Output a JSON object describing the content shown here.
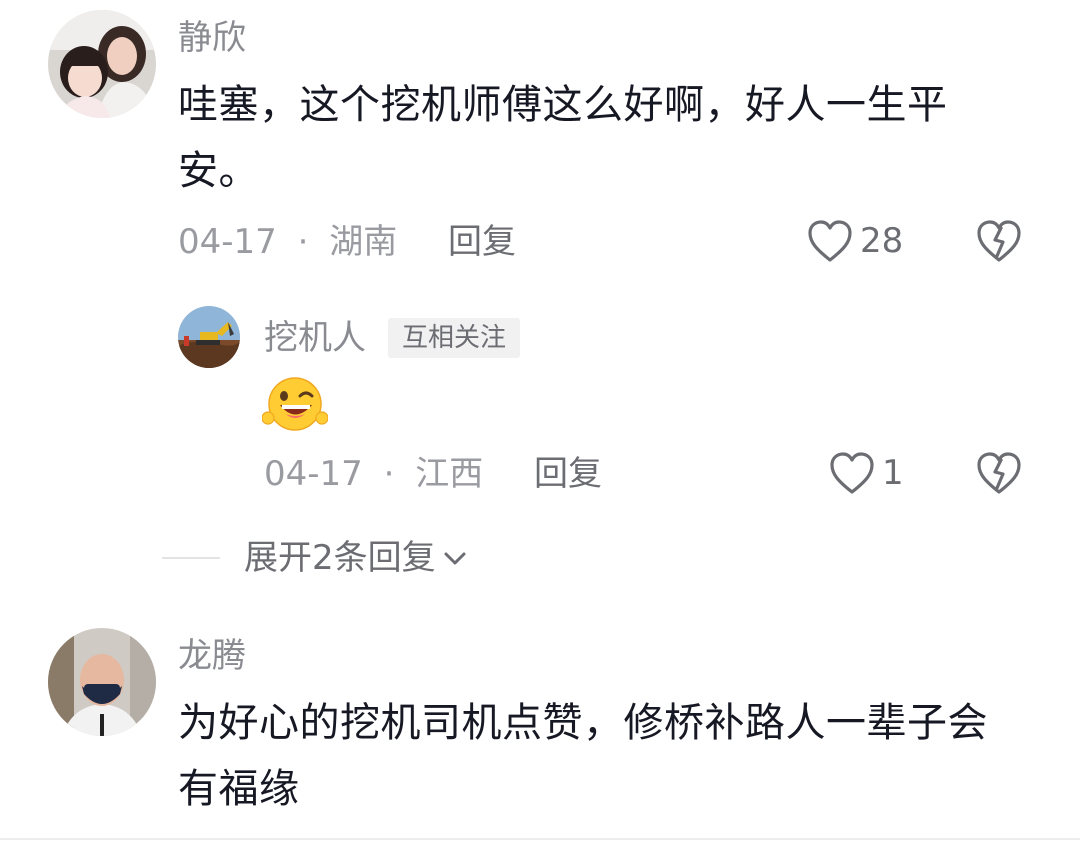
{
  "comments": [
    {
      "username": "静欣",
      "content": "哇塞，这个挖机师傅这么好啊，好人一生平安。",
      "date": "04-17",
      "separator": "·",
      "location": "湖南",
      "reply_label": "回复",
      "like_count": "28",
      "avatar_icon": "mother-daughter-photo"
    },
    {
      "username": "龙腾",
      "content": "为好心的挖机司机点赞，修桥补路人一辈子会有福缘",
      "avatar_icon": "man-with-mask-photo"
    }
  ],
  "reply": {
    "username": "挖机人",
    "badge": "互相关注",
    "emoji_icon": "grinning-wink-emoji",
    "date": "04-17",
    "separator": "·",
    "location": "江西",
    "reply_label": "回复",
    "like_count": "1",
    "avatar_icon": "excavator-photo"
  },
  "expand_replies": {
    "label": "展开2条回复"
  },
  "colors": {
    "text_primary": "#161823",
    "text_secondary": "#8a8b91",
    "badge_bg": "#f1f1f2"
  }
}
